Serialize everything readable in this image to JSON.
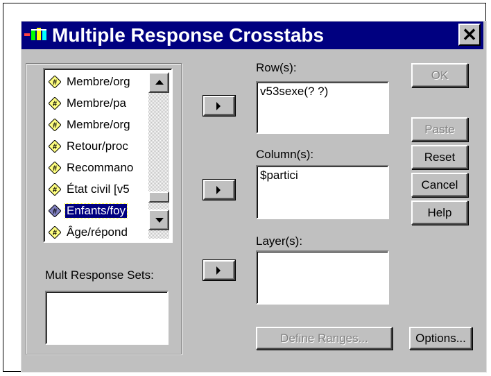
{
  "dialog": {
    "title": "Multiple Response Crosstabs",
    "close_glyph": "✕"
  },
  "variables": [
    {
      "label": "Membre/org",
      "icon": "multi-response-set-icon",
      "selected": false
    },
    {
      "label": "Membre/pa",
      "icon": "multi-response-set-icon",
      "selected": false
    },
    {
      "label": "Membre/org",
      "icon": "multi-response-set-icon",
      "selected": false
    },
    {
      "label": "Retour/proc",
      "icon": "multi-response-set-icon",
      "selected": false
    },
    {
      "label": "Recommano",
      "icon": "multi-response-set-icon",
      "selected": false
    },
    {
      "label": "État civil [v5",
      "icon": "multi-response-set-icon",
      "selected": false
    },
    {
      "label": "Enfants/foy",
      "icon": "multi-response-set-icon",
      "selected": true
    },
    {
      "label": "Âge/répond",
      "icon": "multi-response-set-icon",
      "selected": false
    }
  ],
  "mult_response_sets": {
    "label": "Mult Response Sets:",
    "items": []
  },
  "rows": {
    "label": "Row(s):",
    "value": "v53sexe(? ?)"
  },
  "columns": {
    "label": "Column(s):",
    "value": "$partici"
  },
  "layers": {
    "label": "Layer(s):",
    "value": ""
  },
  "buttons": {
    "ok": "OK",
    "paste": "Paste",
    "reset": "Reset",
    "cancel": "Cancel",
    "help": "Help",
    "define_ranges": "Define Ranges...",
    "options": "Options..."
  },
  "colors": {
    "titlebar": "#000080",
    "face": "#c0c0c0",
    "selection": "#000080"
  }
}
